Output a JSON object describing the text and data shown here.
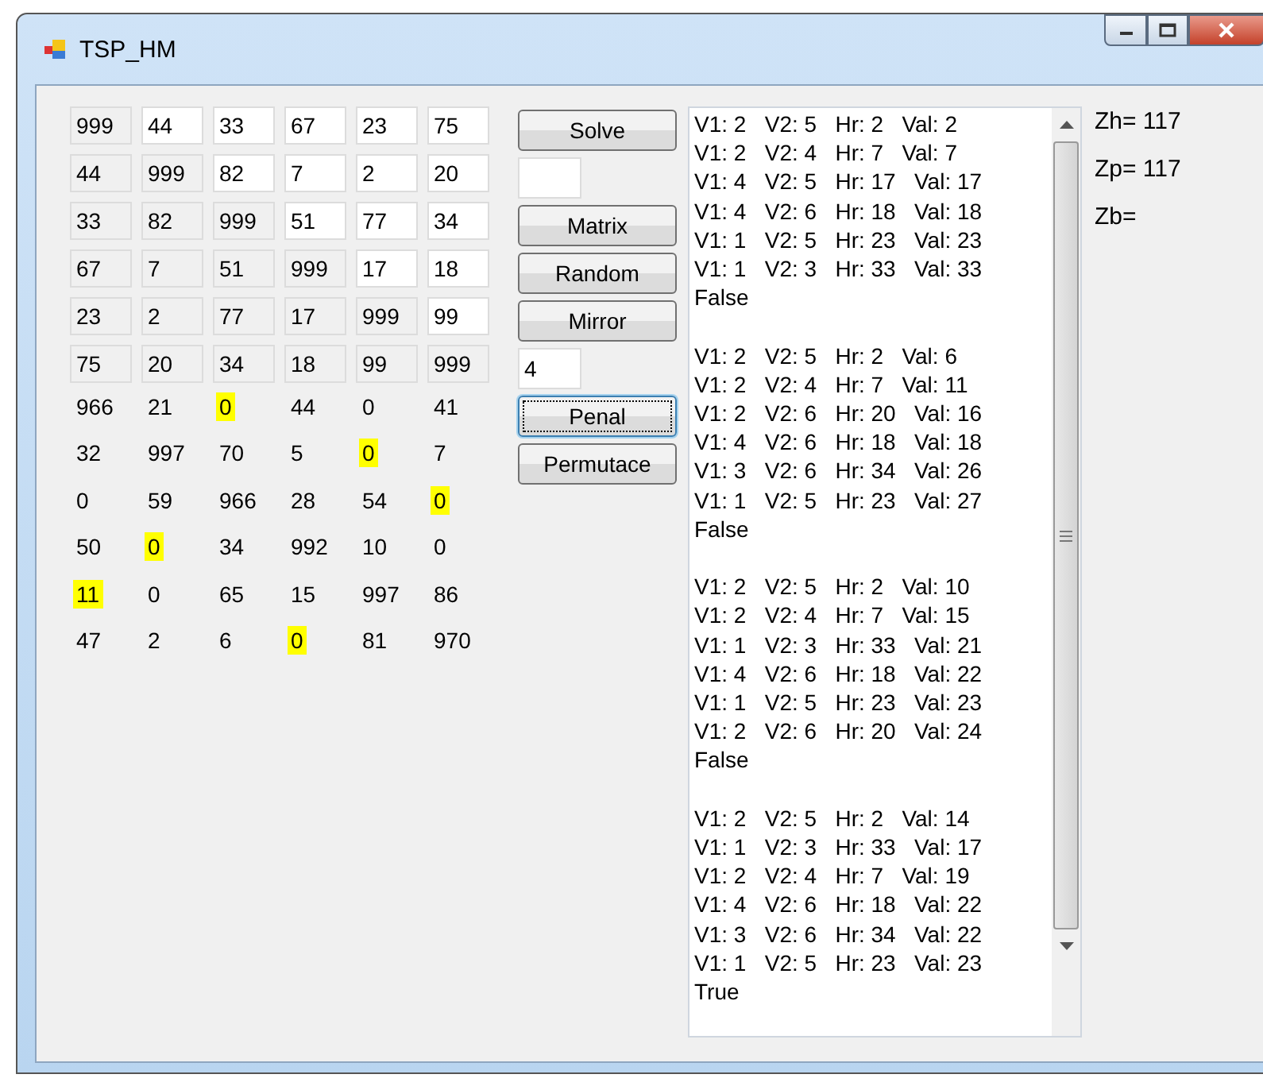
{
  "window": {
    "title": "TSP_HM"
  },
  "matrix": [
    [
      {
        "value": "999",
        "disabled": true
      },
      {
        "value": "44",
        "disabled": false
      },
      {
        "value": "33",
        "disabled": false
      },
      {
        "value": "67",
        "disabled": false
      },
      {
        "value": "23",
        "disabled": false
      },
      {
        "value": "75",
        "disabled": false
      }
    ],
    [
      {
        "value": "44",
        "disabled": true
      },
      {
        "value": "999",
        "disabled": true
      },
      {
        "value": "82",
        "disabled": false
      },
      {
        "value": "7",
        "disabled": false
      },
      {
        "value": "2",
        "disabled": false
      },
      {
        "value": "20",
        "disabled": false
      }
    ],
    [
      {
        "value": "33",
        "disabled": true
      },
      {
        "value": "82",
        "disabled": true
      },
      {
        "value": "999",
        "disabled": true
      },
      {
        "value": "51",
        "disabled": false
      },
      {
        "value": "77",
        "disabled": false
      },
      {
        "value": "34",
        "disabled": false
      }
    ],
    [
      {
        "value": "67",
        "disabled": true
      },
      {
        "value": "7",
        "disabled": true
      },
      {
        "value": "51",
        "disabled": true
      },
      {
        "value": "999",
        "disabled": true
      },
      {
        "value": "17",
        "disabled": false
      },
      {
        "value": "18",
        "disabled": false
      }
    ],
    [
      {
        "value": "23",
        "disabled": true
      },
      {
        "value": "2",
        "disabled": true
      },
      {
        "value": "77",
        "disabled": true
      },
      {
        "value": "17",
        "disabled": true
      },
      {
        "value": "999",
        "disabled": true
      },
      {
        "value": "99",
        "disabled": false
      }
    ],
    [
      {
        "value": "75",
        "disabled": true
      },
      {
        "value": "20",
        "disabled": true
      },
      {
        "value": "34",
        "disabled": true
      },
      {
        "value": "18",
        "disabled": true
      },
      {
        "value": "99",
        "disabled": true
      },
      {
        "value": "999",
        "disabled": true
      }
    ]
  ],
  "result_matrix": [
    [
      {
        "value": "966",
        "highlighted": false
      },
      {
        "value": "21",
        "highlighted": false
      },
      {
        "value": "0",
        "highlighted": true
      },
      {
        "value": "44",
        "highlighted": false
      },
      {
        "value": "0",
        "highlighted": false
      },
      {
        "value": "41",
        "highlighted": false
      }
    ],
    [
      {
        "value": "32",
        "highlighted": false
      },
      {
        "value": "997",
        "highlighted": false
      },
      {
        "value": "70",
        "highlighted": false
      },
      {
        "value": "5",
        "highlighted": false
      },
      {
        "value": "0",
        "highlighted": true
      },
      {
        "value": "7",
        "highlighted": false
      }
    ],
    [
      {
        "value": "0",
        "highlighted": false
      },
      {
        "value": "59",
        "highlighted": false
      },
      {
        "value": "966",
        "highlighted": false
      },
      {
        "value": "28",
        "highlighted": false
      },
      {
        "value": "54",
        "highlighted": false
      },
      {
        "value": "0",
        "highlighted": true
      }
    ],
    [
      {
        "value": "50",
        "highlighted": false
      },
      {
        "value": "0",
        "highlighted": true
      },
      {
        "value": "34",
        "highlighted": false
      },
      {
        "value": "992",
        "highlighted": false
      },
      {
        "value": "10",
        "highlighted": false
      },
      {
        "value": "0",
        "highlighted": false
      }
    ],
    [
      {
        "value": "11",
        "highlighted": true
      },
      {
        "value": "0",
        "highlighted": false
      },
      {
        "value": "65",
        "highlighted": false
      },
      {
        "value": "15",
        "highlighted": false
      },
      {
        "value": "997",
        "highlighted": false
      },
      {
        "value": "86",
        "highlighted": false
      }
    ],
    [
      {
        "value": "47",
        "highlighted": false
      },
      {
        "value": "2",
        "highlighted": false
      },
      {
        "value": "6",
        "highlighted": false
      },
      {
        "value": "0",
        "highlighted": true
      },
      {
        "value": "81",
        "highlighted": false
      },
      {
        "value": "970",
        "highlighted": false
      }
    ]
  ],
  "controls": [
    {
      "kind": "button",
      "label": "Solve",
      "focused": false
    },
    {
      "kind": "field"
    },
    {
      "kind": "button",
      "label": "Matrix",
      "focused": false
    },
    {
      "kind": "button",
      "label": "Random",
      "focused": false
    },
    {
      "kind": "button",
      "label": "Mirror",
      "focused": false
    },
    {
      "kind": "field",
      "value": "4"
    },
    {
      "kind": "button",
      "label": "Penal",
      "focused": true
    },
    {
      "kind": "button",
      "label": "Permutace",
      "focused": false
    }
  ],
  "log": [
    {
      "lines": [
        "V1: 2   V2: 5   Hr: 2   Val: 2",
        "V1: 2   V2: 4   Hr: 7   Val: 7",
        "V1: 4   V2: 5   Hr: 17   Val: 17",
        "V1: 4   V2: 6   Hr: 18   Val: 18",
        "V1: 1   V2: 5   Hr: 23   Val: 23",
        "V1: 1   V2: 3   Hr: 33   Val: 33"
      ],
      "result": "False"
    },
    {
      "lines": [
        "V1: 2   V2: 5   Hr: 2   Val: 6",
        "V1: 2   V2: 4   Hr: 7   Val: 11",
        "V1: 2   V2: 6   Hr: 20   Val: 16",
        "V1: 4   V2: 6   Hr: 18   Val: 18",
        "V1: 3   V2: 6   Hr: 34   Val: 26",
        "V1: 1   V2: 5   Hr: 23   Val: 27"
      ],
      "result": "False"
    },
    {
      "lines": [
        "V1: 2   V2: 5   Hr: 2   Val: 10",
        "V1: 2   V2: 4   Hr: 7   Val: 15",
        "V1: 1   V2: 3   Hr: 33   Val: 21",
        "V1: 4   V2: 6   Hr: 18   Val: 22",
        "V1: 1   V2: 5   Hr: 23   Val: 23",
        "V1: 2   V2: 6   Hr: 20   Val: 24"
      ],
      "result": "False"
    },
    {
      "lines": [
        "V1: 2   V2: 5   Hr: 2   Val: 14",
        "V1: 1   V2: 3   Hr: 33   Val: 17",
        "V1: 2   V2: 4   Hr: 7   Val: 19",
        "V1: 4   V2: 6   Hr: 18   Val: 22",
        "V1: 3   V2: 6   Hr: 34   Val: 22",
        "V1: 1   V2: 5   Hr: 23   Val: 23"
      ],
      "result": "True"
    }
  ],
  "results": [
    "Zh= 117",
    "Zp= 117",
    "Zb="
  ]
}
